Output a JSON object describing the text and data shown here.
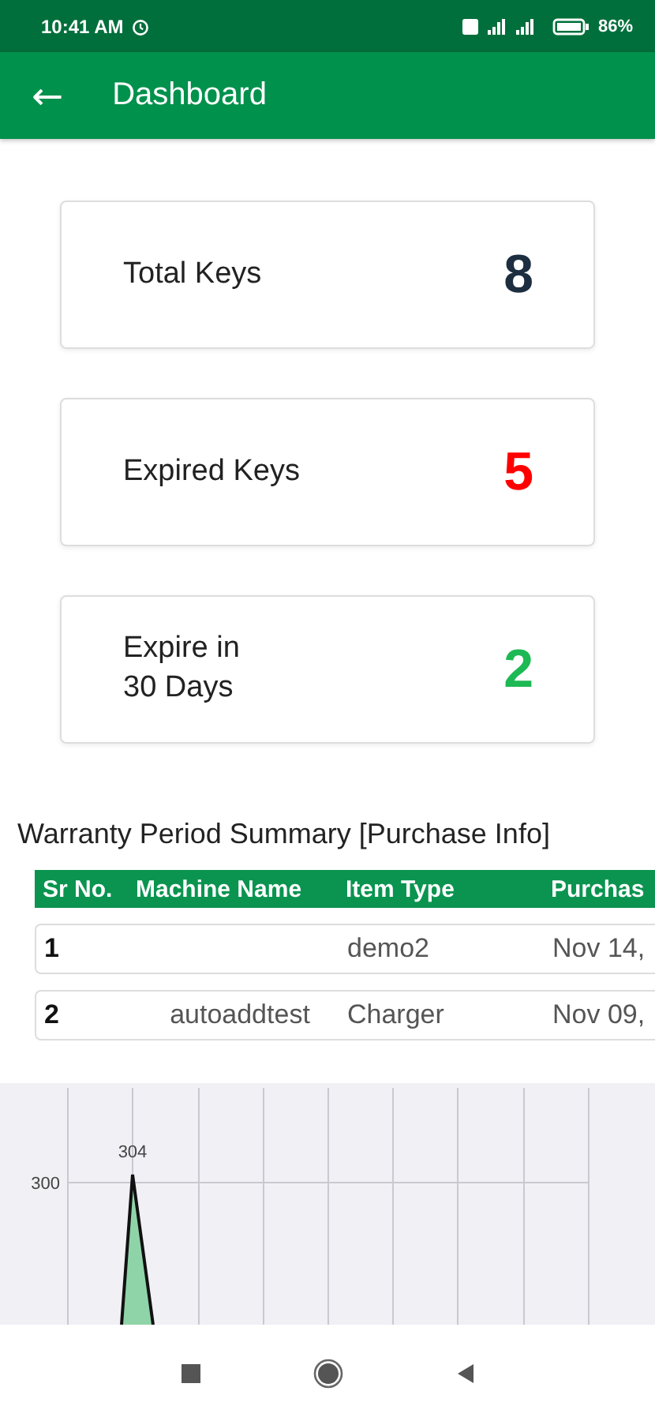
{
  "status_bar": {
    "time": "10:41 AM",
    "battery": "86%"
  },
  "app_bar": {
    "back": "←",
    "title": "Dashboard"
  },
  "cards": [
    {
      "label": "Total Keys",
      "value": "8",
      "color": "#1c2e40"
    },
    {
      "label": "Expired Keys",
      "value": "5",
      "color": "#ff0000"
    },
    {
      "label": "Expire in\n30 Days",
      "value": "2",
      "color": "#1db954"
    }
  ],
  "table": {
    "title": "Warranty Period Summary [Purchase Info]",
    "columns": [
      "Sr No.",
      "Machine Name",
      "Item Type",
      "Purchas"
    ],
    "rows": [
      [
        "1",
        "",
        "demo2",
        "Nov 14,"
      ],
      [
        "2",
        "autoaddtest",
        "Charger",
        "Nov 09,"
      ]
    ]
  },
  "chart": {
    "y_tick": "300",
    "data_label": "304"
  }
}
